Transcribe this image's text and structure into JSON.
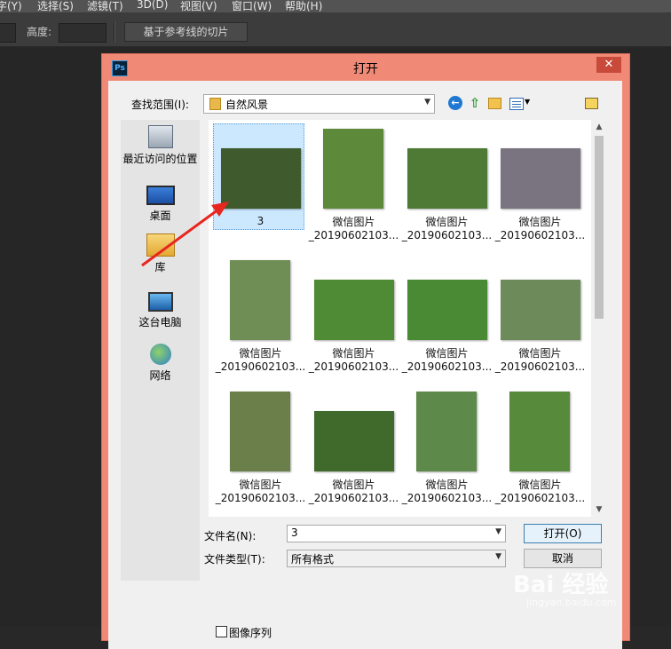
{
  "menubar": [
    "字(Y)",
    "选择(S)",
    "滤镜(T)",
    "3D(D)",
    "视图(V)",
    "窗口(W)",
    "帮助(H)"
  ],
  "optionsbar": {
    "height_label": "高度:",
    "guide_slice_button": "基于参考线的切片"
  },
  "dialog": {
    "app_icon": "Ps",
    "title": "打开",
    "close": "✕",
    "look_in_label": "查找范围(I):",
    "look_in_value": "自然风景",
    "places": [
      {
        "label": "最近访问的位置",
        "icon": "recent-places-icon"
      },
      {
        "label": "桌面",
        "icon": "desktop-icon"
      },
      {
        "label": "库",
        "icon": "library-icon"
      },
      {
        "label": "这台电脑",
        "icon": "this-pc-icon"
      },
      {
        "label": "网络",
        "icon": "network-icon"
      }
    ],
    "files": [
      {
        "line1": "3",
        "line2": "",
        "selected": true,
        "color": "#3f5a2c"
      },
      {
        "line1": "微信图片",
        "line2": "_20190602103...",
        "color": "#5d8a3a"
      },
      {
        "line1": "微信图片",
        "line2": "_20190602103...",
        "color": "#4f7a36"
      },
      {
        "line1": "微信图片",
        "line2": "_20190602103...",
        "color": "#7a7480"
      },
      {
        "line1": "微信图片",
        "line2": "_20190602103...",
        "color": "#6f8e55"
      },
      {
        "line1": "微信图片",
        "line2": "_20190602103...",
        "color": "#4f8b34"
      },
      {
        "line1": "微信图片",
        "line2": "_20190602103...",
        "color": "#4a8a34"
      },
      {
        "line1": "微信图片",
        "line2": "_20190602103...",
        "color": "#6d8a5a"
      },
      {
        "line1": "微信图片",
        "line2": "_20190602103...",
        "color": "#6a7f4a"
      },
      {
        "line1": "微信图片",
        "line2": "_20190602103...",
        "color": "#3f6a2c"
      },
      {
        "line1": "微信图片",
        "line2": "_20190602103...",
        "color": "#5d8a4a"
      },
      {
        "line1": "微信图片",
        "line2": "_20190602103...",
        "color": "#588a3c"
      }
    ],
    "file_name_label": "文件名(N):",
    "file_name_value": "3",
    "file_type_label": "文件类型(T):",
    "file_type_value": "所有格式",
    "open_button": "打开(O)",
    "cancel_button": "取消",
    "image_sequence_label": "图像序列",
    "image_sequence_checked": false
  },
  "watermark": {
    "brand": "Bai 经验",
    "url": "jingyan.baidu.com"
  }
}
